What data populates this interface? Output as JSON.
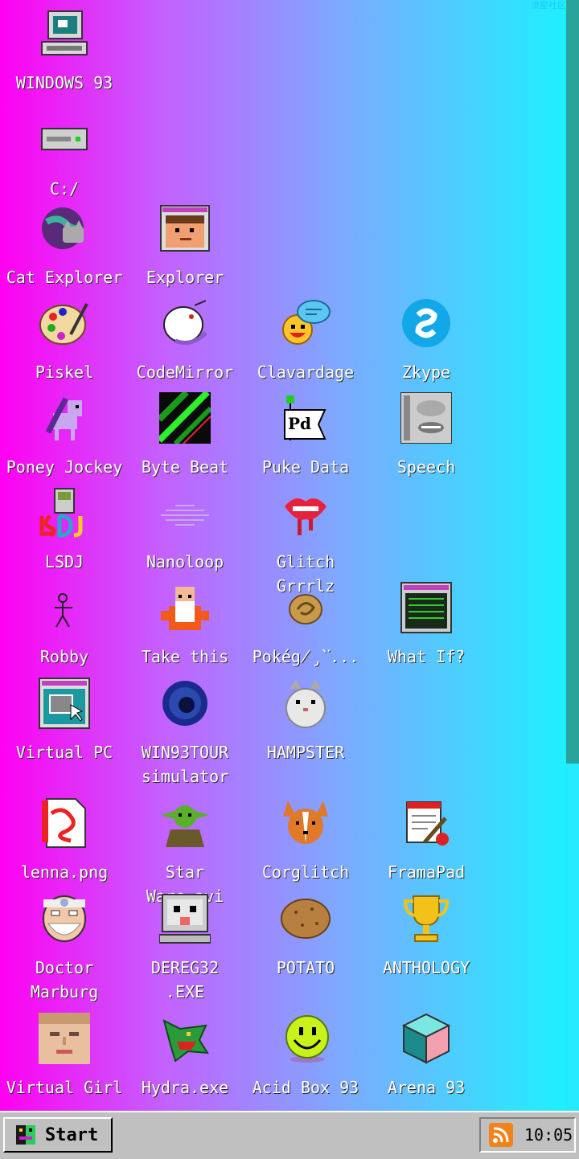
{
  "watermark": "流星社区",
  "icons": [
    {
      "label": "WINDOWS 93"
    },
    {
      "label": "C:/"
    },
    {
      "label": "Cat Explorer"
    },
    {
      "label": "Explorer"
    },
    {
      "label": "Piskel"
    },
    {
      "label": "CodeMirror"
    },
    {
      "label": "Clavardage"
    },
    {
      "label": "Zkype"
    },
    {
      "label": "Poney Jockey"
    },
    {
      "label": "Byte Beat"
    },
    {
      "label": "Puke Data"
    },
    {
      "label": "Speech"
    },
    {
      "label": "LSDJ"
    },
    {
      "label": "Nanoloop"
    },
    {
      "label": "Glitch Grrrlz"
    },
    {
      "label": "Robby"
    },
    {
      "label": "Take this"
    },
    {
      "label": "Pokég̸̡̀͘..."
    },
    {
      "label": "What If?"
    },
    {
      "label": "Virtual PC"
    },
    {
      "label": "WIN93TOUR\nsimulator"
    },
    {
      "label": "HAMPSTER"
    },
    {
      "label": "lenna.png"
    },
    {
      "label": "Star Wars.avi"
    },
    {
      "label": "Corglitch"
    },
    {
      "label": "FramaPad"
    },
    {
      "label": "Doctor\nMarburg"
    },
    {
      "label": "DEREG32\n.EXE"
    },
    {
      "label": "POTATO"
    },
    {
      "label": "ANTHOLOGY"
    },
    {
      "label": "Virtual Girl"
    },
    {
      "label": "Hydra.exe"
    },
    {
      "label": "Acid Box 93"
    },
    {
      "label": "Arena 93"
    }
  ],
  "taskbar": {
    "start_label": "Start",
    "clock": "10:05"
  }
}
